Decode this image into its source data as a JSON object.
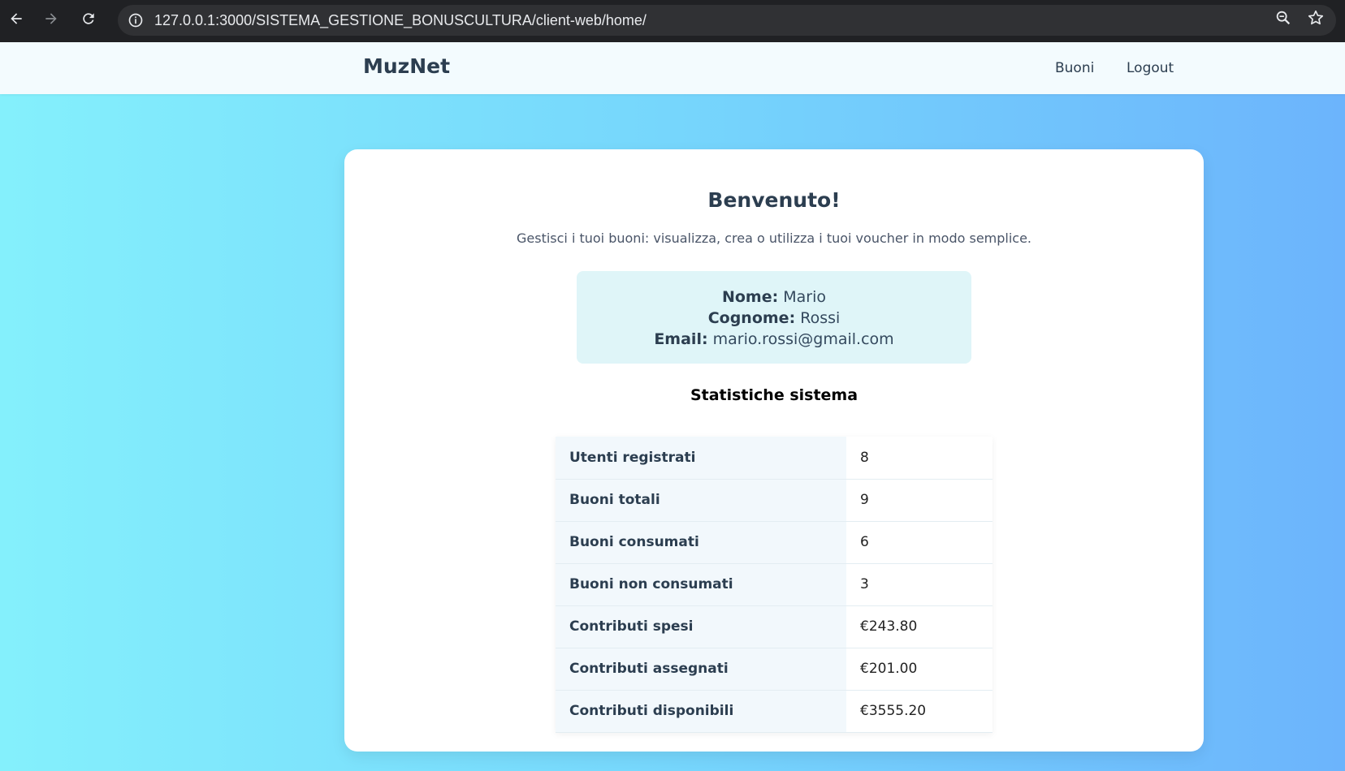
{
  "browser": {
    "url": "127.0.0.1:3000/SISTEMA_GESTIONE_BONUSCULTURA/client-web/home/",
    "icons": [
      "back-icon",
      "forward-icon",
      "reload-icon",
      "info-icon",
      "zoom-icon",
      "star-icon"
    ]
  },
  "navbar": {
    "brand": "MuzNet",
    "links": [
      {
        "label": "Buoni"
      },
      {
        "label": "Logout"
      }
    ]
  },
  "main": {
    "title": "Benvenuto!",
    "subtitle": "Gestisci i tuoi buoni: visualizza, crea o utilizza i tuoi voucher in modo semplice.",
    "user": {
      "name_label": "Nome:",
      "name": "Mario",
      "surname_label": "Cognome:",
      "surname": "Rossi",
      "email_label": "Email:",
      "email": "mario.rossi@gmail.com"
    },
    "stats_title": "Statistiche sistema",
    "stats": [
      {
        "label": "Utenti registrati",
        "value": "8"
      },
      {
        "label": "Buoni totali",
        "value": "9"
      },
      {
        "label": "Buoni consumati",
        "value": "6"
      },
      {
        "label": "Buoni non consumati",
        "value": "3"
      },
      {
        "label": "Contributi spesi",
        "value": "€243.80"
      },
      {
        "label": "Contributi assegnati",
        "value": "€201.00"
      },
      {
        "label": "Contributi disponibili",
        "value": "€3555.20"
      }
    ]
  },
  "colors": {
    "background_start": "#84f0fc",
    "background_end": "#6cb4fc",
    "text_dark": "#2c3e50",
    "user_box": "#dff5f8"
  }
}
